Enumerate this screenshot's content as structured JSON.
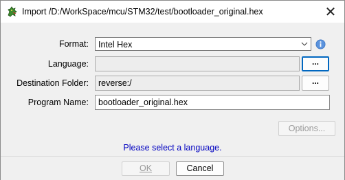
{
  "window": {
    "title": "Import /D:/WorkSpace/mcu/STM32/test/bootloader_original.hex",
    "close_glyph": "✕"
  },
  "form": {
    "format_label": "Format:",
    "format_value": "Intel Hex",
    "language_label": "Language:",
    "language_value": "",
    "language_browse": "...",
    "destination_label": "Destination Folder:",
    "destination_value": "reverse:/",
    "destination_browse": "...",
    "program_label": "Program Name:",
    "program_value": "bootloader_original.hex",
    "options_label": "Options..."
  },
  "status_message": "Please select a language.",
  "buttons": {
    "ok_label": "OK",
    "cancel_label": "Cancel"
  },
  "colors": {
    "status_text": "#0000c0",
    "info_icon": "#3a74c4",
    "focus_border": "#0067c0"
  },
  "icons": {
    "app": "dragon-icon",
    "info": "info-icon",
    "dropdown": "chevron-down-icon",
    "close": "close-icon"
  }
}
